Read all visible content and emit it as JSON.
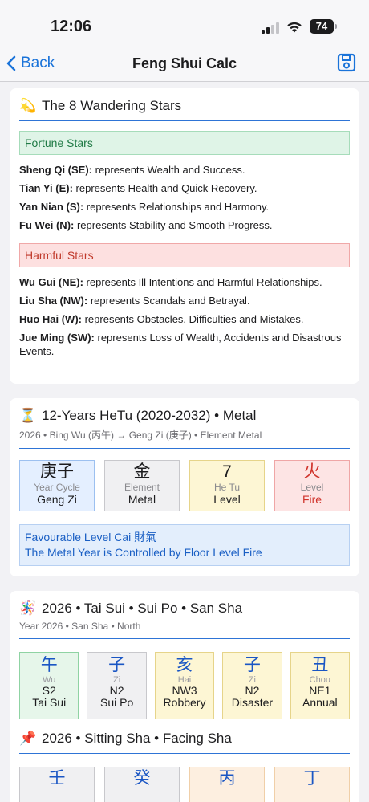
{
  "status": {
    "time": "12:06",
    "battery": "74"
  },
  "nav": {
    "back_label": "Back",
    "title": "Feng Shui Calc"
  },
  "stars": {
    "icon": "comet-emoji",
    "title": "The 8 Wandering Stars",
    "fortune_label": "Fortune Stars",
    "fortune": [
      {
        "name": "Sheng Qi (SE):",
        "desc": " represents Wealth and Success."
      },
      {
        "name": "Tian Yi (E):",
        "desc": " represents Health and Quick Recovery."
      },
      {
        "name": "Yan Nian (S):",
        "desc": " represents Relationships and Harmony."
      },
      {
        "name": "Fu Wei (N):",
        "desc": " represents Stability and Smooth Progress."
      }
    ],
    "harmful_label": "Harmful Stars",
    "harmful": [
      {
        "name": "Wu Gui (NE):",
        "desc": " represents Ill Intentions and Harmful Relationships."
      },
      {
        "name": "Liu Sha (NW):",
        "desc": " represents Scandals and Betrayal."
      },
      {
        "name": "Huo Hai (W):",
        "desc": " represents Obstacles, Difficulties and Mistakes."
      },
      {
        "name": "Jue Ming (SW):",
        "desc": " represents Loss of Wealth, Accidents and Disastrous Events."
      }
    ]
  },
  "hetu": {
    "icon": "hourglass-emoji",
    "title": "12-Years HeTu (2020-2032) • Metal",
    "subtitle": "2026 • Bing Wu (丙午) → Geng Zi (庚子) • Element Metal",
    "boxes": [
      {
        "big": "庚子",
        "label": "Year Cycle",
        "value": "Geng Zi",
        "color": "blue"
      },
      {
        "big": "金",
        "label": "Element",
        "value": "Metal",
        "color": "gray"
      },
      {
        "big": "7",
        "label": "He Tu",
        "value": "Level",
        "color": "yellow"
      },
      {
        "big": "火",
        "label": "Level",
        "value": "Fire",
        "color": "red"
      }
    ],
    "info_line1": "Favourable Level Cai 財氣",
    "info_line2": "The Metal Year is Controlled by Floor Level Fire"
  },
  "taisui": {
    "icon": "pinwheel-emoji",
    "title": "2026 • Tai Sui • Sui Po • San Sha",
    "subtitle": "Year 2026 • San Sha • North",
    "boxes": [
      {
        "big": "午",
        "label": "Wu",
        "code": "S2",
        "value": "Tai Sui",
        "color": "green"
      },
      {
        "big": "子",
        "label": "Zi",
        "code": "N2",
        "value": "Sui Po",
        "color": "gray"
      },
      {
        "big": "亥",
        "label": "Hai",
        "code": "NW3",
        "value": "Robbery",
        "color": "yellow"
      },
      {
        "big": "子",
        "label": "Zi",
        "code": "N2",
        "value": "Disaster",
        "color": "yellow"
      },
      {
        "big": "丑",
        "label": "Chou",
        "code": "NE1",
        "value": "Annual",
        "color": "yellow"
      }
    ]
  },
  "sitting": {
    "icon": "pushpin-emoji",
    "title": "2026 • Sitting Sha • Facing Sha",
    "boxes": [
      {
        "big": "壬",
        "color": "gray"
      },
      {
        "big": "癸",
        "color": "gray"
      },
      {
        "big": "丙",
        "color": "peach"
      },
      {
        "big": "丁",
        "color": "peach"
      }
    ]
  }
}
